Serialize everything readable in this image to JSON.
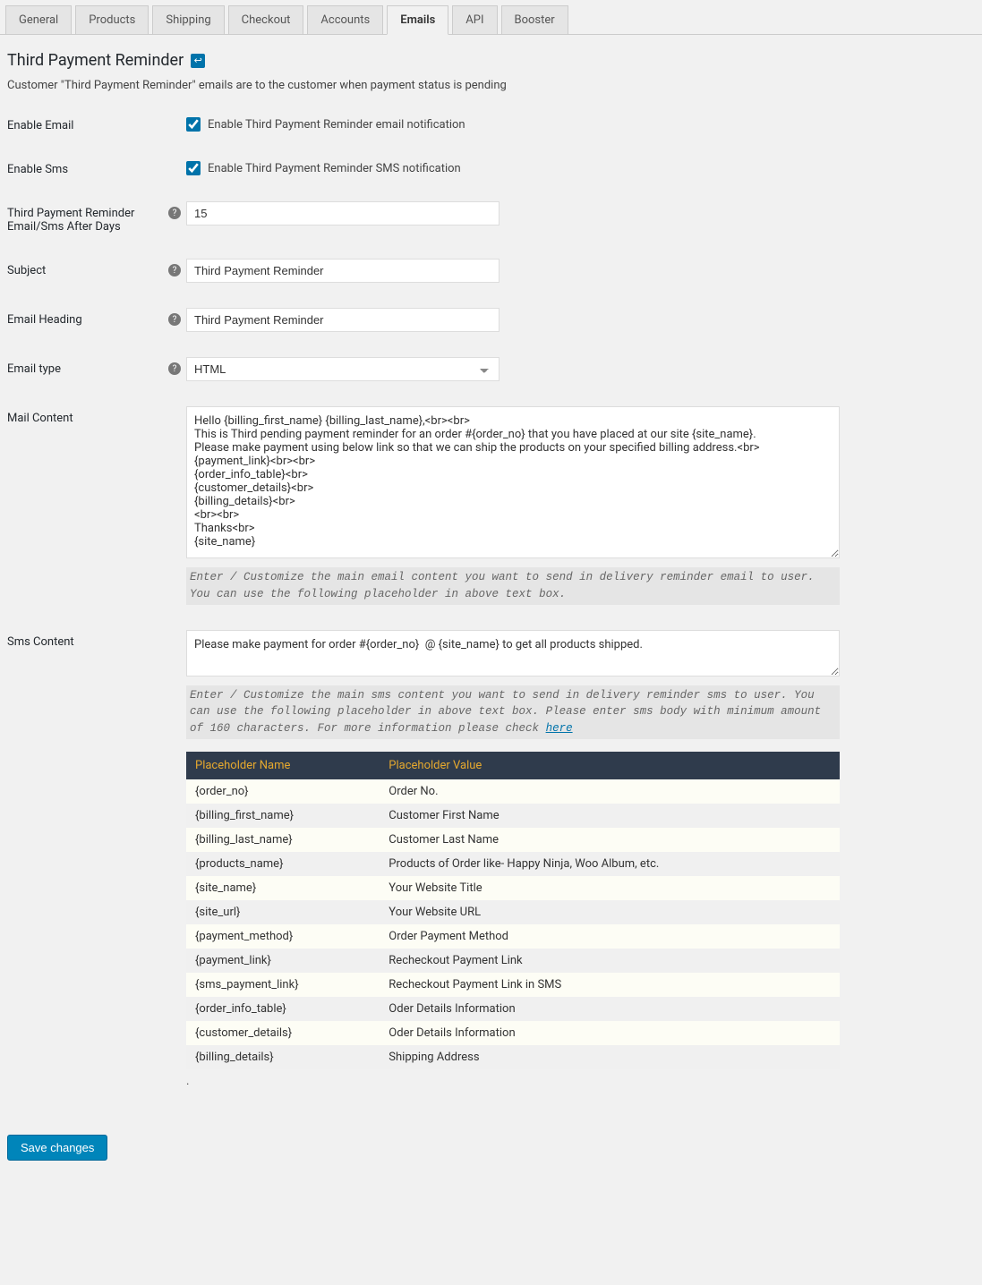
{
  "tabs": [
    "General",
    "Products",
    "Shipping",
    "Checkout",
    "Accounts",
    "Emails",
    "API",
    "Booster"
  ],
  "active_tab": "Emails",
  "page": {
    "title": "Third Payment Reminder",
    "description": "Customer \"Third Payment Reminder\" emails are to the customer when payment status is pending"
  },
  "fields": {
    "enable_email": {
      "label": "Enable Email",
      "checkbox_label": "Enable Third Payment Reminder email notification",
      "checked": true
    },
    "enable_sms": {
      "label": "Enable Sms",
      "checkbox_label": "Enable Third Payment Reminder SMS notification",
      "checked": true
    },
    "after_days": {
      "label": "Third Payment Reminder Email/Sms After Days",
      "value": "15"
    },
    "subject": {
      "label": "Subject",
      "value": "Third Payment Reminder"
    },
    "email_heading": {
      "label": "Email Heading",
      "value": "Third Payment Reminder"
    },
    "email_type": {
      "label": "Email type",
      "value": "HTML"
    },
    "mail_content": {
      "label": "Mail Content",
      "value": "Hello {billing_first_name} {billing_last_name},<br><br>\nThis is Third pending payment reminder for an order #{order_no} that you have placed at our site {site_name}.\nPlease make payment using below link so that we can ship the products on your specified billing address.<br>\n{payment_link}<br><br>\n{order_info_table}<br>\n{customer_details}<br>\n{billing_details}<br>\n<br><br>\nThanks<br>\n{site_name}",
      "help": "Enter / Customize the main email content you want to send in delivery reminder email to user. You can use the following placeholder in above text box."
    },
    "sms_content": {
      "label": "Sms Content",
      "value": "Please make payment for order #{order_no}  @ {site_name} to get all products shipped.",
      "help_pre": "Enter / Customize the main sms content you want to send in delivery reminder sms to user. You can use the following placeholder in above text box. Please enter sms body with minimum amount of 160 characters. For more information please check ",
      "help_link": "here"
    }
  },
  "placeholder_table": {
    "headers": [
      "Placeholder Name",
      "Placeholder Value"
    ],
    "rows": [
      [
        "{order_no}",
        "Order No."
      ],
      [
        "{billing_first_name}",
        "Customer First Name"
      ],
      [
        "{billing_last_name}",
        "Customer Last Name"
      ],
      [
        "{products_name}",
        "Products of Order like- Happy Ninja, Woo Album, etc."
      ],
      [
        "{site_name}",
        "Your Website Title"
      ],
      [
        "{site_url}",
        "Your Website URL"
      ],
      [
        "{payment_method}",
        "Order Payment Method"
      ],
      [
        "{payment_link}",
        "Recheckout Payment Link"
      ],
      [
        "{sms_payment_link}",
        "Recheckout Payment Link in SMS"
      ],
      [
        "{order_info_table}",
        "Oder Details Information"
      ],
      [
        "{customer_details}",
        "Oder Details Information"
      ],
      [
        "{billing_details}",
        "Shipping Address"
      ]
    ]
  },
  "save_button": "Save changes"
}
